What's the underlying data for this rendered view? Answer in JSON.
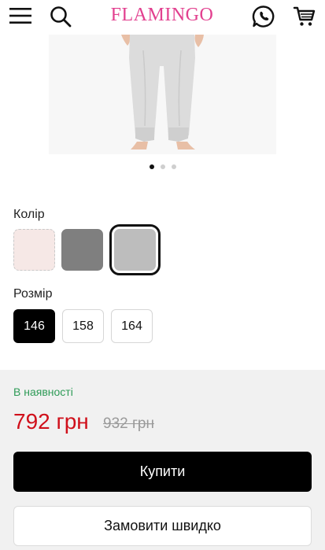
{
  "header": {
    "logo": "FLAMINGO",
    "icons": [
      "hamburger-menu-icon",
      "search-icon",
      "chat-phone-icon",
      "cart-icon"
    ]
  },
  "gallery": {
    "image": "product-photo-grey-joggers",
    "dots": 3,
    "active_dot": 1
  },
  "color": {
    "label": "Колір",
    "swatches": [
      {
        "name": "pink",
        "hex": "#f6e8e6",
        "selected": false
      },
      {
        "name": "dark-grey",
        "hex": "#7f7f7f",
        "selected": false
      },
      {
        "name": "light-grey",
        "hex": "#bdbdbd",
        "selected": true
      }
    ]
  },
  "size": {
    "label": "Розмір",
    "options": [
      "146",
      "158",
      "164"
    ],
    "selected": "146"
  },
  "buy": {
    "stock": "В наявності",
    "price": "792 грн",
    "old_price": "932 грн",
    "buy_button": "Купити",
    "quick_button": "Замовити швидко"
  },
  "colors": {
    "logo": "#e2408f",
    "price": "#d0101b",
    "stock": "#2e9b57",
    "primary_button": "#000000",
    "panel_bg": "#f1f1f1"
  }
}
